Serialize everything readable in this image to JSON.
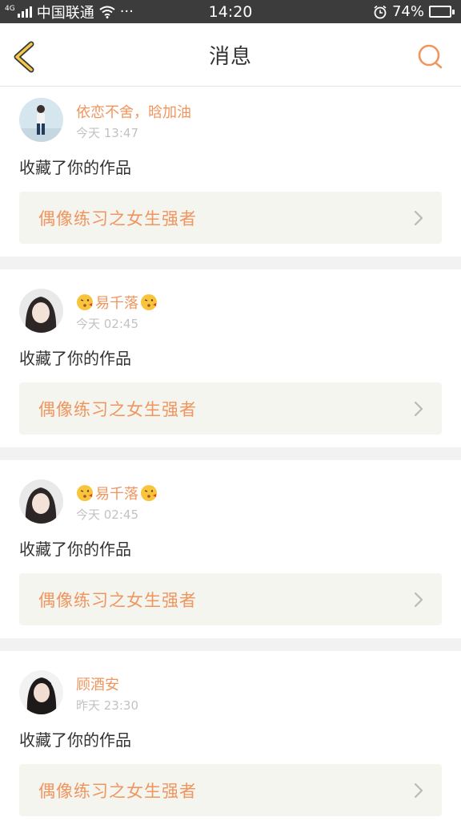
{
  "status_bar": {
    "network_tag": "4G",
    "carrier": "中国联通",
    "more": "···",
    "time": "14:20",
    "battery_percent": "74%",
    "battery_level": 0.74
  },
  "header": {
    "title": "消息",
    "back_icon": "back-chevron-icon",
    "search_icon": "search-icon",
    "accent_color": "#f0955e"
  },
  "notifications": [
    {
      "username": "依恋不舍，晗加油",
      "time": "今天 13:47",
      "action": "收藏了你的作品",
      "work_title": "偶像练习之女生强者"
    },
    {
      "username": "易千落",
      "time": "今天 02:45",
      "action": "收藏了你的作品",
      "work_title": "偶像练习之女生强者"
    },
    {
      "username": "易千落",
      "time": "今天 02:45",
      "action": "收藏了你的作品",
      "work_title": "偶像练习之女生强者"
    },
    {
      "username": "顾酒安",
      "time": "昨天 23:30",
      "action": "收藏了你的作品",
      "work_title": "偶像练习之女生强者"
    }
  ]
}
